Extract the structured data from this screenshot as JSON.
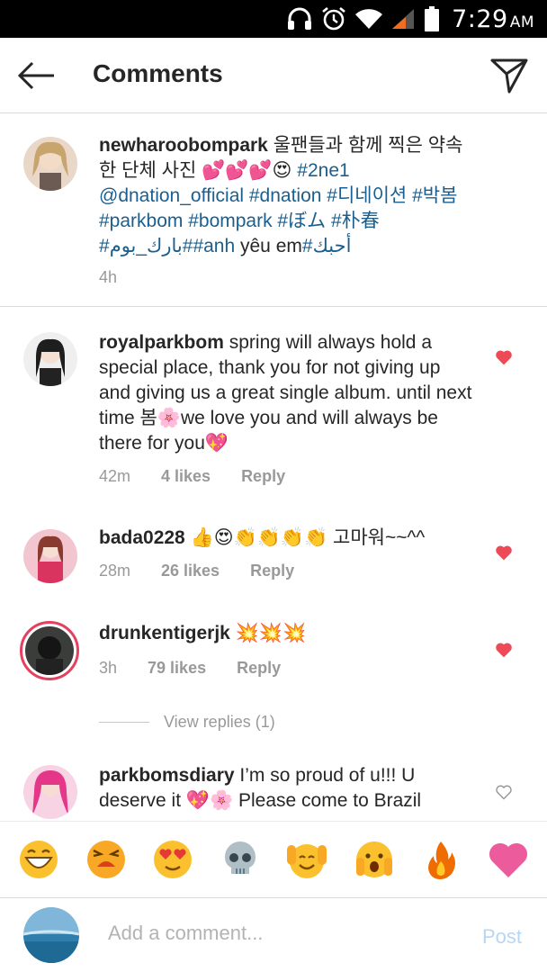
{
  "status_bar": {
    "time": "7:29",
    "ampm": "AM",
    "icons": [
      "headphones-icon",
      "alarm-icon",
      "wifi-icon",
      "signal-icon",
      "battery-icon"
    ]
  },
  "header": {
    "title": "Comments",
    "back_icon": "arrow-left-icon",
    "send_icon": "direct-send-icon"
  },
  "caption": {
    "username": "newharoobompark",
    "text_parts": [
      "울팬들과 함께 찍은 약속한 단체 사진 ",
      "💕💕💕😍",
      " "
    ],
    "tags_line": "#2ne1 @dnation_official #dnation #디네이션 #박봄 #parkbom #bompark #ぼム #朴春#بارك_بوم##anh",
    "tail": " yêu em",
    "tail_tag": "#أحبك",
    "time": "4h"
  },
  "comments": [
    {
      "username": "royalparkbom",
      "text": "spring will always hold a special place, thank you for not giving up and giving us a great single album. until next time 봄🌸we love you and will always be there for you💖",
      "time": "42m",
      "likes": "4 likes",
      "reply": "Reply",
      "liked": true
    },
    {
      "username": "bada0228",
      "text": "👍😍👏👏👏👏 고마워~~^^",
      "time": "28m",
      "likes": "26 likes",
      "reply": "Reply",
      "liked": true
    },
    {
      "username": "drunkentigerjk",
      "text": "💥💥💥",
      "time": "3h",
      "likes": "79 likes",
      "reply": "Reply",
      "liked": true
    },
    {
      "username": "parkbomsdiary",
      "text": "I’m so proud of u!!! U deserve it 💖🌸 Please come to Brazil",
      "liked": false
    }
  ],
  "view_replies": "View replies (1)",
  "emoji_bar": [
    "grinning-face",
    "tired-face",
    "heart-eyes-face",
    "skull",
    "raised-hands-face",
    "fearful-face",
    "fire",
    "heart"
  ],
  "composer": {
    "placeholder": "Add a comment...",
    "post_label": "Post"
  },
  "colors": {
    "heart": "#ed4956",
    "link": "#1a5f8f",
    "story_ring": "#e4405f",
    "post_disabled": "#b6d7f3"
  }
}
